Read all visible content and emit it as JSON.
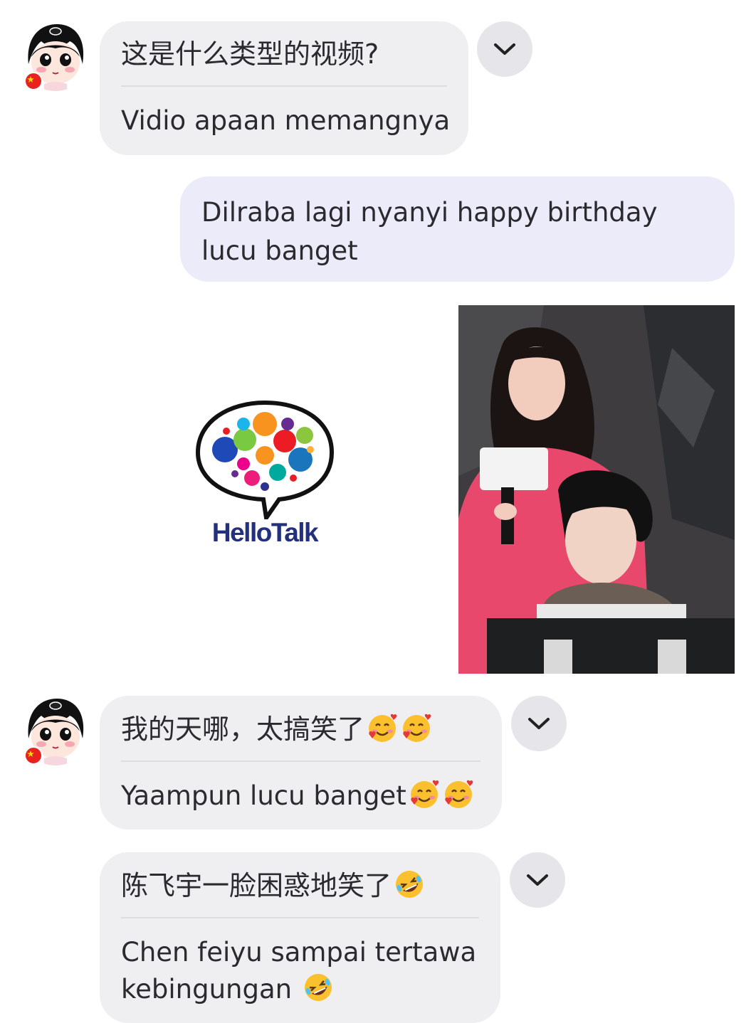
{
  "messages": [
    {
      "id": "m1",
      "original": "这是什么类型的视频?",
      "translation": "Vidio apaan memangnya"
    },
    {
      "id": "m2",
      "text": "Dilraba lagi nyanyi happy birthday lucu banget"
    },
    {
      "id": "m3",
      "original": "我的天哪，太搞笑了",
      "translation": "Yaampun lucu banget",
      "emoji": "smiling-face-with-hearts"
    },
    {
      "id": "m4",
      "original": "陈飞宇一脸困惑地笑了",
      "translation": "Chen feiyu sampai tertawa kebingungan",
      "emoji": "rolling-on-floor-laughing"
    }
  ],
  "logo": {
    "text": "HelloTalk",
    "text_color": "#23307e"
  },
  "colors": {
    "received_bubble": "#efeff2",
    "sent_bubble": "#ecebfa",
    "divider": "#dcdce2",
    "chevron_button": "#e6e6ea"
  },
  "icons": {
    "expand": "chevron-down-icon",
    "flag": "china-flag-icon"
  }
}
